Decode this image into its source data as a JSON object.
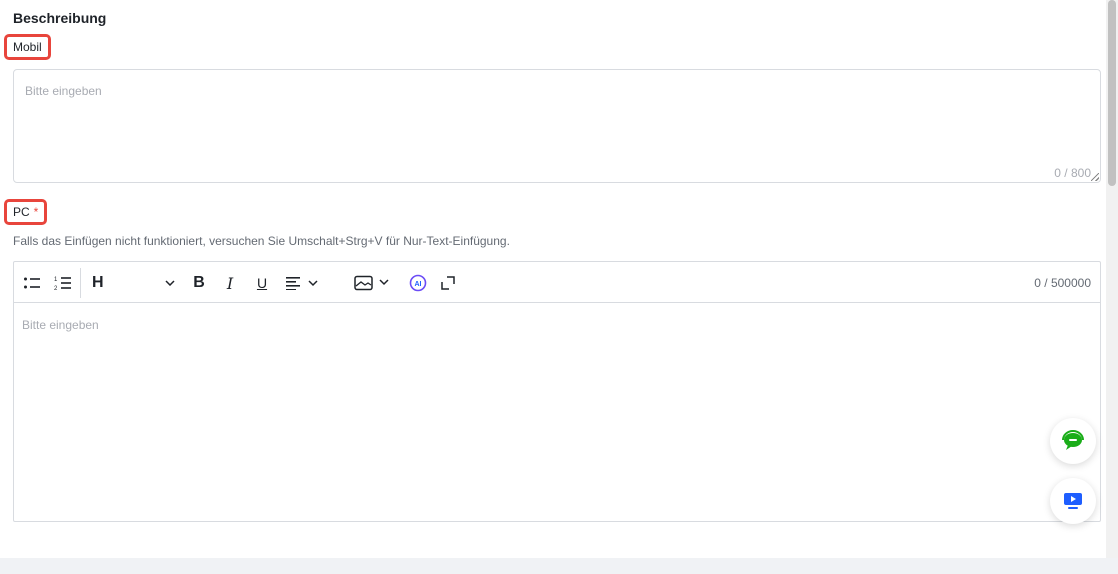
{
  "section": {
    "title": "Beschreibung"
  },
  "mobile": {
    "label": "Mobil",
    "placeholder": "Bitte eingeben",
    "counter": "0 / 800"
  },
  "pc": {
    "label": "PC",
    "required_mark": "*",
    "hint": "Falls das Einfügen nicht funktioniert, versuchen Sie Umschalt+Strg+V für Nur-Text-Einfügung.",
    "placeholder": "Bitte eingeben",
    "counter": "0 / 500000",
    "toolbar": {
      "heading_label": "H",
      "bold_label": "B",
      "italic_label": "I",
      "underline_label": "U",
      "ai_label": "AI"
    }
  },
  "colors": {
    "highlight": "#e8453c",
    "support_icon": "#1aad19",
    "demo_icon": "#1e5eff",
    "ai_icon": "#6b4cf6"
  },
  "icons": {
    "support": "chat-headset-icon",
    "demo": "video-monitor-icon"
  }
}
